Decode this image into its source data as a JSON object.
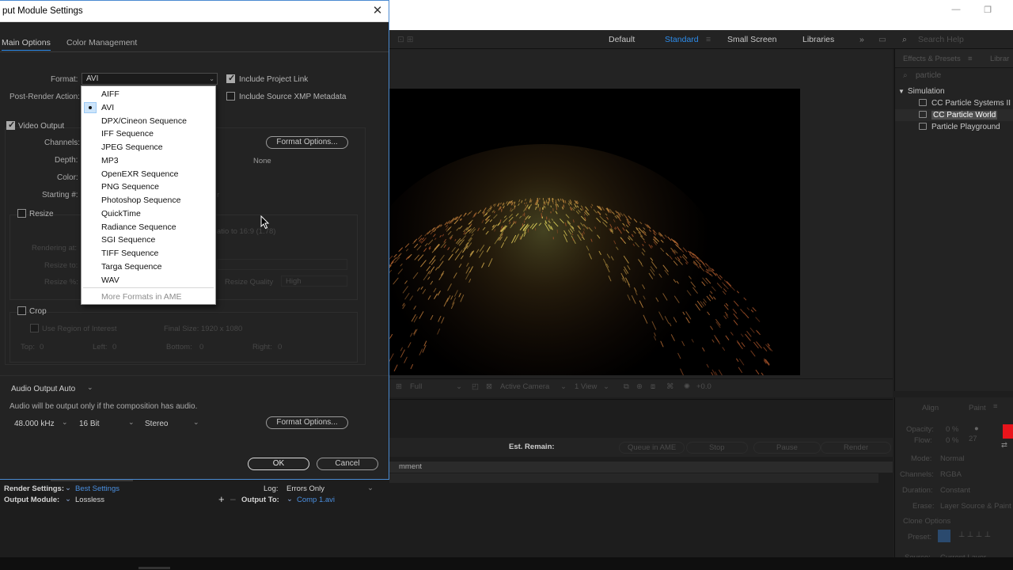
{
  "dialog": {
    "title": "put Module Settings",
    "tabs": [
      "Main Options",
      "Color Management"
    ],
    "format_label": "Format:",
    "format_value": "AVI",
    "post_render_label": "Post-Render Action:",
    "include_project_link": "Include Project Link",
    "include_xmp": "Include Source XMP Metadata",
    "video_output": "Video Output",
    "channels_label": "Channels:",
    "depth_label": "Depth:",
    "color_label": "Color:",
    "starting_label": "Starting #:",
    "format_options": "Format Options...",
    "none_text": "None",
    "resize": "Resize",
    "rendering_at": "Rendering at:",
    "resize_to": "Resize to:",
    "resize_pct": "Resize %:",
    "ratio_text": "atio to 16:9 (1.78)",
    "resize_quality": "Resize Quality",
    "resize_quality_value": "High",
    "crop": "Crop",
    "use_roi": "Use Region of Interest",
    "final_size": "Final Size: 1920 x 1080",
    "top_label": "Top:",
    "top_value": "0",
    "left_label": "Left:",
    "left_value": "0",
    "bottom_label": "Bottom:",
    "bottom_value": "0",
    "right_label": "Right:",
    "right_value": "0",
    "audio_output": "Audio Output Auto",
    "audio_note": "Audio will be output only if the composition has audio.",
    "sample_rate": "48.000 kHz",
    "bit_depth": "16 Bit",
    "channels_audio": "Stereo",
    "audio_format_options": "Format Options...",
    "ok": "OK",
    "cancel": "Cancel"
  },
  "format_menu": {
    "items": [
      "AIFF",
      "AVI",
      "DPX/Cineon Sequence",
      "IFF Sequence",
      "JPEG Sequence",
      "MP3",
      "OpenEXR Sequence",
      "PNG Sequence",
      "Photoshop Sequence",
      "QuickTime",
      "Radiance Sequence",
      "SGI Sequence",
      "TIFF Sequence",
      "Targa Sequence",
      "WAV"
    ],
    "selected": "AVI",
    "more": "More Formats in AME"
  },
  "workspaces": {
    "items": [
      "Default",
      "Standard",
      "Small Screen",
      "Libraries"
    ],
    "active": "Standard",
    "search_placeholder": "Search Help"
  },
  "effects_panel": {
    "tab": "Effects & Presets",
    "tab2": "Librar",
    "search_value": "particle",
    "folder": "Simulation",
    "items": [
      "CC Particle Systems II",
      "CC Particle World",
      "Particle Playground"
    ],
    "selected": "CC Particle World"
  },
  "viewer_toolbar": {
    "quality": "Full",
    "camera": "Active Camera",
    "views": "1 View",
    "exposure": "+0.0"
  },
  "render_queue": {
    "est_remain": "Est. Remain:",
    "queue_ame": "Queue in AME",
    "stop": "Stop",
    "pause": "Pause",
    "render": "Render",
    "comment_header": "mment",
    "render_settings_label": "Render Settings:",
    "render_settings_value": "Best Settings",
    "output_module_label": "Output Module:",
    "output_module_value": "Lossless",
    "log_label": "Log:",
    "log_value": "Errors Only",
    "output_to_label": "Output To:",
    "output_to_value": "Comp 1.avi"
  },
  "paint_panel": {
    "tab_align": "Align",
    "tab_paint": "Paint",
    "opacity": "Opacity:",
    "opacity_value": "0 %",
    "flow": "Flow:",
    "flow_value": "0 %",
    "brush_size": "27",
    "mode": "Mode:",
    "mode_value": "Normal",
    "channels": "Channels:",
    "channels_value": "RGBA",
    "duration": "Duration:",
    "duration_value": "Constant",
    "erase": "Erase:",
    "erase_value": "Layer Source & Paint",
    "clone_options": "Clone Options",
    "preset": "Preset:",
    "source": "Source:",
    "source_value": "Current Layer",
    "fg_color": "#e8141b"
  }
}
